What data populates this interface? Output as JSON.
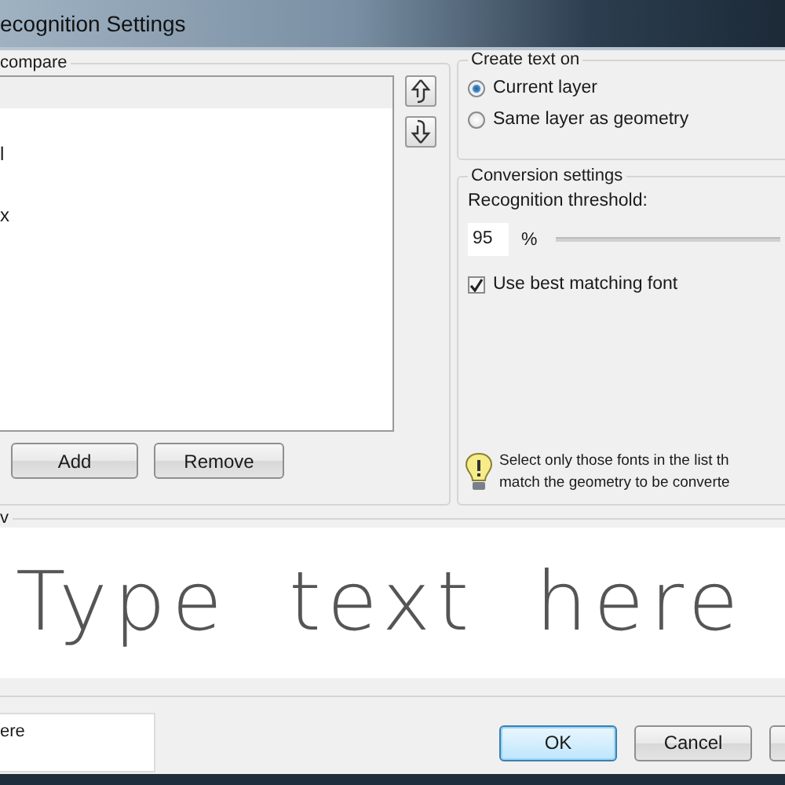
{
  "window": {
    "title": "ecognition Settings"
  },
  "fonts_group": {
    "label": "compare",
    "items": [
      {
        "text": "l"
      },
      {
        "text": "x"
      }
    ],
    "buttons": [
      "Add",
      "Remove"
    ]
  },
  "create_text_on": {
    "label": "Create text on",
    "options": [
      {
        "label": "Current layer",
        "selected": true
      },
      {
        "label": "Same layer as geometry",
        "selected": false
      }
    ]
  },
  "conversion_settings": {
    "label": "Conversion settings",
    "threshold_label": "Recognition threshold:",
    "threshold_value": "95",
    "threshold_unit": "%",
    "best_font": {
      "label": "Use best matching font",
      "checked": true
    },
    "hint": [
      "Select only those fonts in the list th",
      "match the geometry to be converte"
    ]
  },
  "preview": {
    "label": "v",
    "sample": "Type text here"
  },
  "sample_field": {
    "value": "ere"
  },
  "buttons": [
    {
      "label": "OK",
      "default": true
    },
    {
      "label": "Cancel",
      "default": false
    },
    {
      "default": false
    }
  ]
}
